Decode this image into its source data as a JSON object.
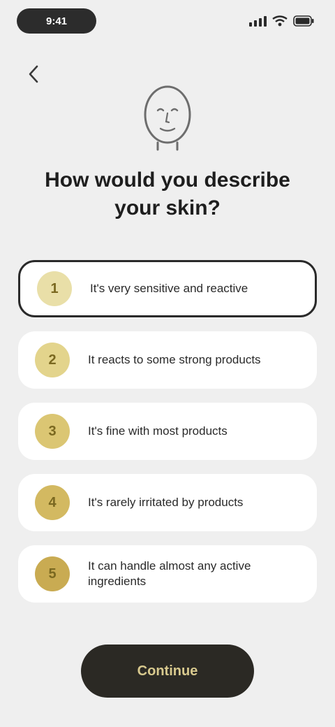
{
  "status_bar": {
    "time": "9:41",
    "icons": [
      "signal-icon",
      "wifi-icon",
      "battery-icon"
    ]
  },
  "header": {
    "back_icon": "chevron-left-icon",
    "illustration_icon": "face-outline-icon",
    "title": "How would you describe your skin?"
  },
  "options": [
    {
      "bullet": "1",
      "label": "It's very sensitive and reactive"
    },
    {
      "bullet": "2",
      "label": "It reacts to some strong products"
    },
    {
      "bullet": "3",
      "label": "It's fine with most products"
    },
    {
      "bullet": "4",
      "label": "It's rarely irritated by products"
    },
    {
      "bullet": "5",
      "label": "It can handle almost any active ingredients"
    }
  ],
  "selected_option_index": 0,
  "footer": {
    "continue_label": "Continue"
  },
  "colors": {
    "background": "#efefef",
    "card": "#ffffff",
    "accent": "#d9c66f",
    "dark": "#2b2924"
  }
}
